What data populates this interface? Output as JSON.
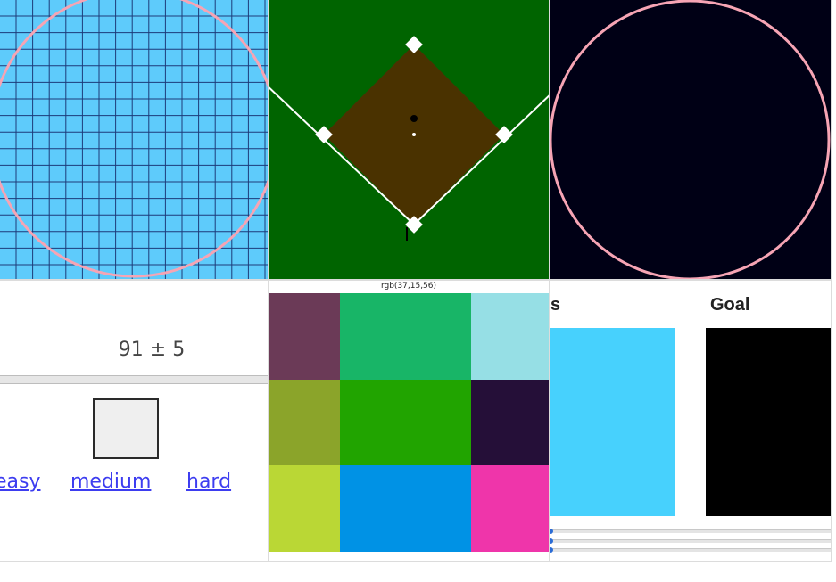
{
  "grid_panel": {
    "background": "#5ecbfb",
    "grid_color": "#1d3b7a",
    "ring_color": "#f6a4b4"
  },
  "baseball_panel": {
    "field_color": "#006400",
    "infield_color": "#4a3200",
    "line_color": "#ffffff"
  },
  "circle_panel": {
    "background": "#000015",
    "ring_color": "#f6a4b4"
  },
  "guess_panel": {
    "estimate_text": "91 ± 5",
    "difficulty_links": [
      "easy",
      "medium",
      "hard"
    ],
    "swatch_color": "#efefef"
  },
  "palette_panel": {
    "rgb_readout": "rgb(37,15,56)",
    "tiles": [
      {
        "color": "#6b3a57"
      },
      {
        "color": "#18b567"
      },
      {
        "color": "#96dfe5"
      },
      {
        "color": "#8ba42a"
      },
      {
        "color": "#21a400"
      },
      {
        "color": "#250f38"
      },
      {
        "color": "#bad735"
      },
      {
        "color": "#0092e5"
      },
      {
        "color": "#ef35aa"
      }
    ]
  },
  "match_panel": {
    "left_label": "s",
    "right_label": "Goal",
    "current_color": "#47d1fd",
    "goal_color": "#000000",
    "slider_count": 3
  }
}
